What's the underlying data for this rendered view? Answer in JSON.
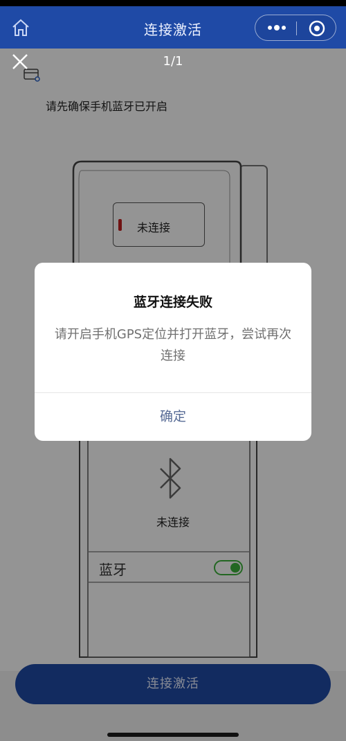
{
  "navbar": {
    "title": "连接激活",
    "home_icon": "home-icon",
    "more_icon": "more-dots-icon",
    "close_target_icon": "target-icon"
  },
  "preview": {
    "close_icon": "close-icon",
    "page_counter": "1/1"
  },
  "page": {
    "hint": "请先确保手机蓝牙已开启",
    "device_status": "未连接",
    "bluetooth_status": "未连接",
    "bluetooth_row_label": "蓝牙",
    "bluetooth_toggle_on": true,
    "activate_button": "连接激活",
    "colors": {
      "brand": "#1f4aa6",
      "led": "#c21f1f",
      "toggle": "#3db13b"
    }
  },
  "dialog": {
    "title": "蓝牙连接失败",
    "message": "请开启手机GPS定位并打开蓝牙，尝试再次连接",
    "confirm": "确定",
    "confirm_color": "#576b95"
  }
}
